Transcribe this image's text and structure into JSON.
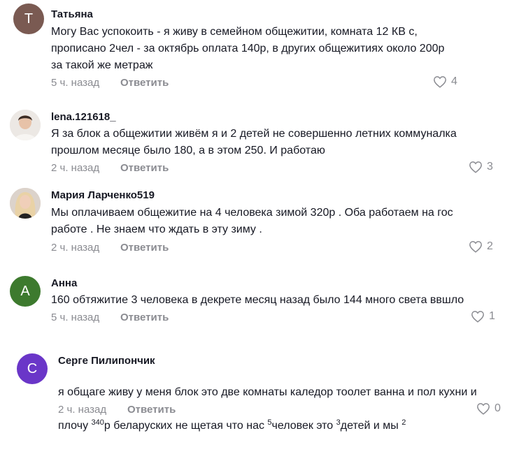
{
  "comments": [
    {
      "author": "Татьяна",
      "avatar_letter": "Т",
      "avatar_color": "#7a5a52",
      "text": "Могу Вас успокоить - я живу в семейном общежитии, комната 12 КВ с,\nпрописано 2чел - за октябрь оплата 140р, в других общежитиях около 200р\nза такой же метраж",
      "time": "5 ч. назад",
      "reply": "Ответить",
      "likes": "4"
    },
    {
      "author": "lena.121618_",
      "avatar_letter": "",
      "text": "Я за блок а общежитии живём я и 2 детей не совершенно летних коммуналка\nпрошлом месяце было 180, а в этом 250. И работаю",
      "time": "2 ч. назад",
      "reply": "Ответить",
      "likes": "3"
    },
    {
      "author": "Мария Ларченко519",
      "avatar_letter": "",
      "text": "Мы оплачиваем общежитие на 4 человека зимой 320р . Оба работаем на гос\nработе . Не знаем что ждать в эту зиму .",
      "time": "2 ч. назад",
      "reply": "Ответить",
      "likes": "2"
    },
    {
      "author": "Анна",
      "avatar_letter": "А",
      "avatar_color": "#3d7a2e",
      "text": "160 обтяжитие 3 человека в декрете месяц назад было 144 много света ввшло",
      "time": "5 ч. назад",
      "reply": "Ответить",
      "likes": "1"
    },
    {
      "author": "Серге Пилипончик",
      "avatar_letter": "С",
      "avatar_color": "#6a36c8",
      "text_line1": "я общаге живу у меня блок это две комнаты каледор тоолет ванна и пол кухни и",
      "text_a": "плочу ",
      "sup_a": "340",
      "text_b": "р беларуских не щетая что нас ",
      "sup_b": "5",
      "text_c": "человек это ",
      "sup_c": "3",
      "text_d": "детей и мы ",
      "sup_d": "2",
      "time": "2 ч. назад",
      "reply": "Ответить",
      "likes": "0"
    }
  ]
}
